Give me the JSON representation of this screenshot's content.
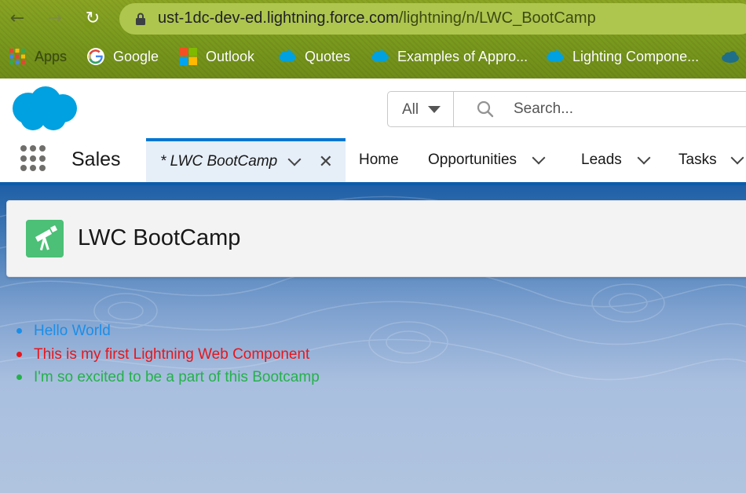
{
  "browser": {
    "url_host": "ust-1dc-dev-ed.lightning.force.com",
    "url_path": "/lightning/n/LWC_BootCamp",
    "bookmarks": [
      {
        "label": "Apps",
        "icon": "apps-grid-icon"
      },
      {
        "label": "Google",
        "icon": "google-icon"
      },
      {
        "label": "Outlook",
        "icon": "outlook-icon"
      },
      {
        "label": "Quotes",
        "icon": "salesforce-cloud-icon"
      },
      {
        "label": "Examples of Appro...",
        "icon": "salesforce-cloud-icon"
      },
      {
        "label": "Lighting Compone...",
        "icon": "salesforce-cloud-icon"
      }
    ]
  },
  "header": {
    "search_scope": "All",
    "search_placeholder": "Search..."
  },
  "nav": {
    "app_name": "Sales",
    "active_tab": "* LWC BootCamp",
    "tabs": [
      "Home",
      "Opportunities",
      "Leads",
      "Tasks"
    ]
  },
  "page": {
    "title": "LWC BootCamp",
    "items": [
      {
        "text": "Hello World",
        "color": "#1b8ee8"
      },
      {
        "text": "This is my first Lightning Web Component",
        "color": "#e8151b"
      },
      {
        "text": "I'm so excited to be a part of this Bootcamp",
        "color": "#24b14a"
      }
    ]
  },
  "colors": {
    "brand_blue": "#0176d3",
    "nav_underline": "#0b5cab",
    "page_icon": "#4bc076"
  }
}
